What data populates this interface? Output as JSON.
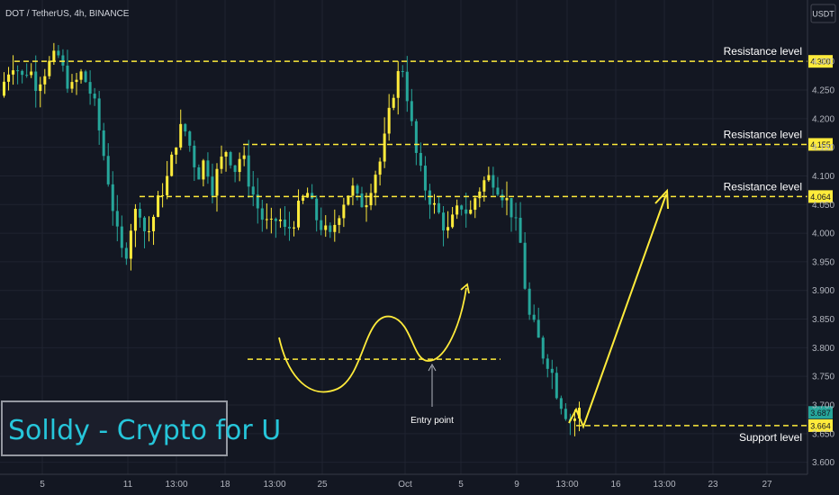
{
  "header": {
    "symbol_title": "DOT / TetherUS, 4h, BINANCE",
    "currency": "USDT"
  },
  "branding": {
    "text": "Solldy - Crypto for U"
  },
  "colors": {
    "background": "#131722",
    "up": "#ffeb3b",
    "down": "#26a69a",
    "level": "#ffeb3b",
    "annotation": "#ffeb3b",
    "brand": "#26c6da"
  },
  "chart_data": {
    "type": "candlestick",
    "ylim": [
      3.59,
      4.36
    ],
    "x_ticks": [
      "5",
      "11",
      "13:00",
      "18",
      "13:00",
      "25",
      "Oct",
      "5",
      "9",
      "13:00",
      "16",
      "13:00",
      "23",
      "27"
    ],
    "y_ticks": [
      "4.300",
      "4.250",
      "4.200",
      "4.150",
      "4.100",
      "4.050",
      "4.000",
      "3.950",
      "3.900",
      "3.850",
      "3.800",
      "3.750",
      "3.700",
      "3.650",
      "3.600"
    ],
    "levels": [
      {
        "label": "Resistance level",
        "value": 4.3
      },
      {
        "label": "Resistance level",
        "value": 4.155
      },
      {
        "label": "Resistance level",
        "value": 4.064
      },
      {
        "label": "Support level",
        "value": 3.664
      }
    ],
    "last_price": 3.687,
    "annotations": {
      "entry_label": "Entry point",
      "entry_level": 3.78
    },
    "price_path": [
      4.24,
      4.28,
      4.3,
      4.27,
      4.29,
      4.26,
      4.28,
      4.3,
      4.31,
      4.27,
      4.25,
      4.28,
      4.26,
      4.22,
      4.15,
      4.08,
      4.0,
      3.95,
      4.02,
      4.05,
      3.99,
      4.03,
      4.07,
      4.1,
      4.16,
      4.19,
      4.15,
      4.1,
      4.13,
      4.08,
      4.12,
      4.15,
      4.11,
      4.14,
      4.09,
      4.05,
      4.02,
      4.01,
      4.03,
      4.0,
      4.02,
      4.05,
      4.07,
      4.03,
      4.01,
      3.99,
      4.03,
      4.06,
      4.08,
      4.05,
      4.06,
      4.1,
      4.13,
      4.2,
      4.27,
      4.29,
      4.2,
      4.12,
      4.08,
      4.05,
      4.03,
      4.0,
      4.03,
      4.05,
      4.03,
      4.07,
      4.09,
      4.1,
      4.08,
      4.06,
      4.03,
      3.98,
      3.86,
      3.83,
      3.79,
      3.77,
      3.72,
      3.69,
      3.67,
      3.69
    ]
  }
}
